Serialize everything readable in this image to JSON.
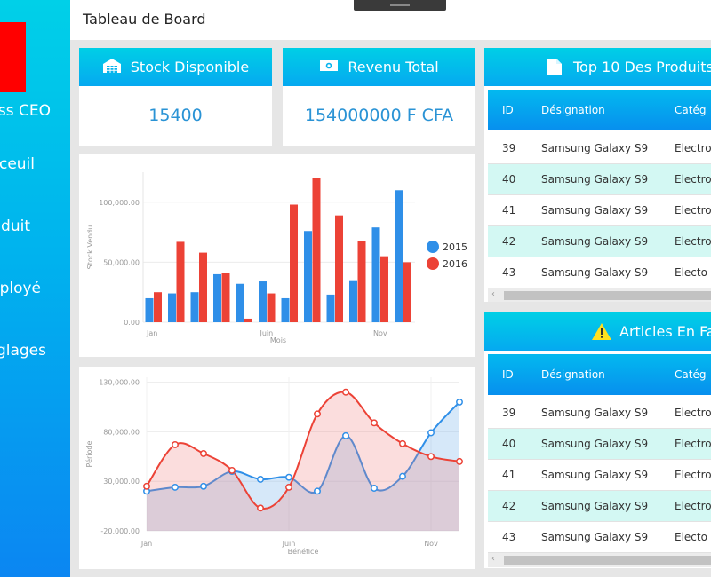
{
  "sidebar": {
    "items": [
      "ss CEO",
      "ceuil",
      "duit",
      "ployé",
      "glages"
    ]
  },
  "topbar": {
    "title": "Tableau de Board"
  },
  "kpis": [
    {
      "label": "Stock Disponible",
      "icon": "warehouse-icon",
      "value": "15400"
    },
    {
      "label": "Revenu Total",
      "icon": "banknote-icon",
      "value": "154000000  F CFA"
    }
  ],
  "colors": {
    "series2015": "#2f8fe8",
    "series2016": "#ec4236",
    "accent": "#05a9f0",
    "row_alt": "#d3f8f3"
  },
  "chart_data": [
    {
      "type": "bar",
      "ylabel": "Stock Vendu",
      "xlabel": "Mois",
      "x_tick_labels": [
        "Jan",
        "Juin",
        "Nov"
      ],
      "y_tick_labels": [
        "0.00",
        "50,000.00",
        "100,000.00"
      ],
      "ylim": [
        0,
        125000
      ],
      "legend": "right",
      "categories": [
        "1",
        "2",
        "3",
        "4",
        "5",
        "6",
        "7",
        "8",
        "9",
        "10",
        "11",
        "12"
      ],
      "series": [
        {
          "name": "2015",
          "values": [
            20000,
            24000,
            25000,
            40000,
            32000,
            34000,
            20000,
            76000,
            23000,
            35000,
            79000,
            110000
          ]
        },
        {
          "name": "2016",
          "values": [
            25000,
            67000,
            58000,
            41000,
            3000,
            24000,
            98000,
            120000,
            89000,
            68000,
            55000,
            50000
          ]
        }
      ]
    },
    {
      "type": "area",
      "ylabel": "Période",
      "xlabel": "Bénéfice",
      "x_tick_labels": [
        "Jan",
        "Juin",
        "Nov"
      ],
      "y_tick_labels": [
        "-20,000.00",
        "30,000.00",
        "80,000.00",
        "130,000.00"
      ],
      "ylim": [
        -20000,
        135000
      ],
      "categories": [
        "1",
        "2",
        "3",
        "4",
        "5",
        "6",
        "7",
        "8",
        "9",
        "10",
        "11",
        "12"
      ],
      "series": [
        {
          "name": "2015",
          "values": [
            20000,
            24000,
            25000,
            40000,
            32000,
            34000,
            20000,
            76000,
            23000,
            35000,
            79000,
            110000
          ]
        },
        {
          "name": "2016",
          "values": [
            25000,
            67000,
            58000,
            41000,
            3000,
            24000,
            98000,
            120000,
            89000,
            68000,
            55000,
            50000
          ]
        }
      ]
    }
  ],
  "top10": {
    "title": "Top 10 Des Produits",
    "headers": [
      "ID",
      "Désignation",
      "Catég"
    ],
    "rows": [
      [
        "39",
        "Samsung Galaxy S9",
        "Electro"
      ],
      [
        "40",
        "Samsung Galaxy S9",
        "Electro"
      ],
      [
        "41",
        "Samsung Galaxy S9",
        "Electro"
      ],
      [
        "42",
        "Samsung Galaxy S9",
        "Electro"
      ],
      [
        "43",
        "Samsung Galaxy S9",
        "Electo"
      ]
    ]
  },
  "faible": {
    "title": "Articles En Fai",
    "headers": [
      "ID",
      "Désignation",
      "Catég"
    ],
    "rows": [
      [
        "39",
        "Samsung Galaxy S9",
        "Electro"
      ],
      [
        "40",
        "Samsung Galaxy S9",
        "Electro"
      ],
      [
        "41",
        "Samsung Galaxy S9",
        "Electro"
      ],
      [
        "42",
        "Samsung Galaxy S9",
        "Electro"
      ],
      [
        "43",
        "Samsung Galaxy S9",
        "Electo"
      ]
    ]
  }
}
